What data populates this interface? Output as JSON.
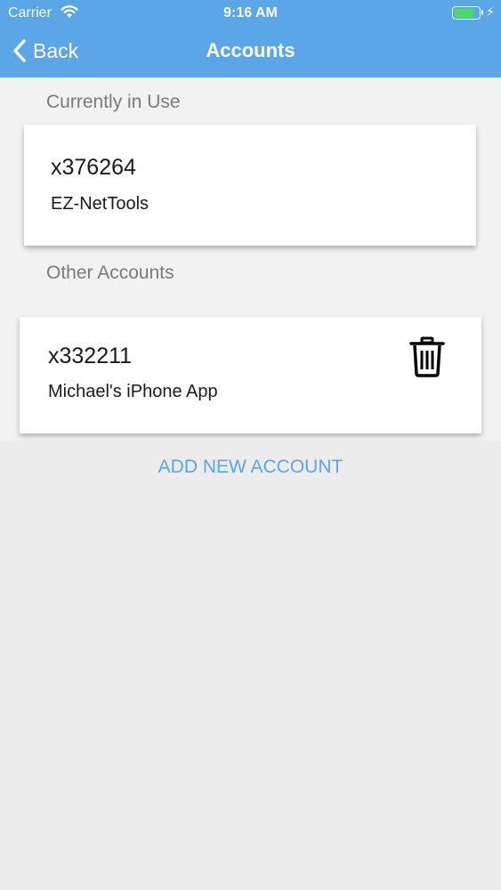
{
  "status_bar": {
    "carrier": "Carrier",
    "time": "9:16 AM",
    "battery_level": 0.8
  },
  "nav": {
    "back_label": "Back",
    "title": "Accounts"
  },
  "sections": {
    "current_label": "Currently in Use",
    "other_label": "Other Accounts"
  },
  "current_account": {
    "id": "x376264",
    "name": "EZ-NetTools"
  },
  "other_accounts": [
    {
      "id": "x332211",
      "name": "Michael's iPhone App",
      "icon": "trash-icon"
    }
  ],
  "actions": {
    "add_new_account": "ADD NEW ACCOUNT"
  },
  "colors": {
    "header": "#5aa6e6",
    "accent": "#5aa6e6",
    "battery": "#4cd964"
  }
}
